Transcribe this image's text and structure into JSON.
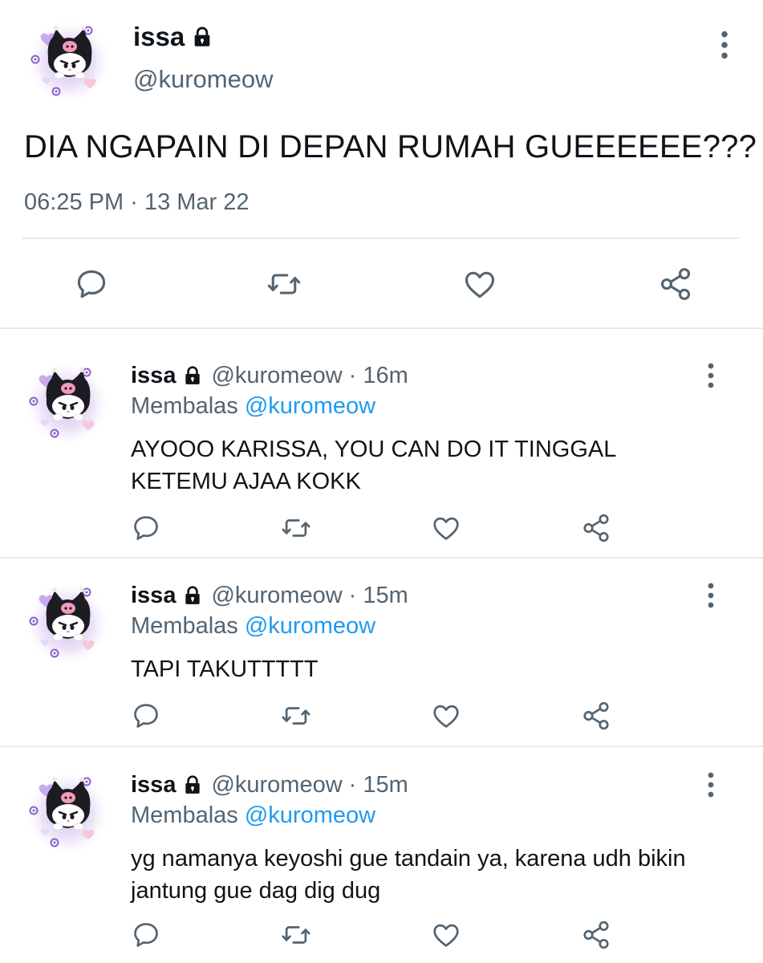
{
  "main_tweet": {
    "display_name": "issa",
    "handle": "@kuromeow",
    "text": "DIA NGAPAIN DI DEPAN RUMAH GUEEEEEE???",
    "time": "06:25 PM",
    "separator": "·",
    "date": "13 Mar 22",
    "icons": [
      "lock-icon",
      "more-vertical-icon",
      "reply-icon",
      "retweet-icon",
      "like-icon",
      "share-icon"
    ]
  },
  "replies": [
    {
      "display_name": "issa",
      "handle": "@kuromeow",
      "separator": "·",
      "time": "16m",
      "replying_prefix": "Membalas",
      "replying_to": "@kuromeow",
      "text": "AYOOO KARISSA, YOU CAN DO IT TINGGAL KETEMU AJAA KOKK"
    },
    {
      "display_name": "issa",
      "handle": "@kuromeow",
      "separator": "·",
      "time": "15m",
      "replying_prefix": "Membalas",
      "replying_to": "@kuromeow",
      "text": "TAPI TAKUTTTTT"
    },
    {
      "display_name": "issa",
      "handle": "@kuromeow",
      "separator": "·",
      "time": "15m",
      "replying_prefix": "Membalas",
      "replying_to": "@kuromeow",
      "text": "yg namanya keyoshi gue tandain ya, karena udh bikin jantung gue dag dig dug"
    }
  ],
  "colors": {
    "text_primary": "#0f1419",
    "text_secondary": "#536471",
    "mention": "#1d9bf0",
    "divider": "#e6e9ec",
    "icon": "#536471",
    "avatar_glow": "#d9c8ee"
  }
}
